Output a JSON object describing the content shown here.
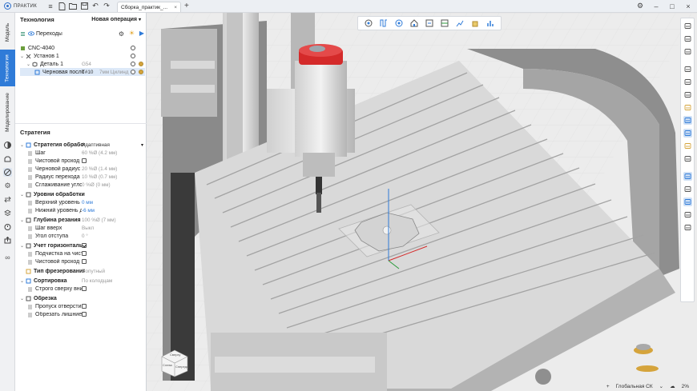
{
  "app": {
    "name": "ПРАКТИК"
  },
  "tabs": [
    {
      "label": "Сборка_практик_..."
    }
  ],
  "left_rail": {
    "tabs": [
      {
        "label": "Модель"
      },
      {
        "label": "Технология"
      },
      {
        "label": "Моделирование"
      }
    ]
  },
  "tech": {
    "title": "Технология",
    "new_op": "Новая операция",
    "transitions": "Переходы",
    "tree": [
      {
        "label": "CNC-4040",
        "value": ""
      },
      {
        "label": "Установ 1",
        "value": ""
      },
      {
        "label": "Деталь 1",
        "value": "G54"
      },
      {
        "label": "Черновая посло...",
        "value": "T#10",
        "extra": "7мм Цилинд"
      }
    ]
  },
  "strategy": {
    "title": "Стратегия",
    "groups": [
      {
        "label": "Стратегия обработ",
        "value": "Адаптивная",
        "items": [
          {
            "label": "Шаг",
            "value": "60 %Ø (4.2 мм)"
          },
          {
            "label": "Чистовой проход",
            "value": ""
          },
          {
            "label": "Черновой радиус",
            "value": "20 %Ø (1.4 мм)"
          },
          {
            "label": "Радиус перехода",
            "value": "10 %Ø (0.7 мм)"
          },
          {
            "label": "Сглаживание угло",
            "value": "0 %Ø (0 мм)"
          }
        ]
      },
      {
        "label": "Уровни обработки",
        "value": "",
        "items": [
          {
            "label": "Верхний уровень",
            "value": "0 мм"
          },
          {
            "label": "Нижний уровень д",
            "value": "-6 мм"
          }
        ]
      },
      {
        "label": "Глубина резания",
        "value": "100 %Ø (7 мм)",
        "items": [
          {
            "label": "Шаг вверх",
            "value": "Выкл"
          },
          {
            "label": "Угол отступа",
            "value": "0 °"
          }
        ]
      },
      {
        "label": "Учет горизонтальн",
        "value": "",
        "items": [
          {
            "label": "Подчистка на чист",
            "value": ""
          },
          {
            "label": "Чистовой проход",
            "value": ""
          }
        ]
      },
      {
        "label": "Тип фрезерования",
        "value": "Попутный",
        "items": []
      },
      {
        "label": "Сортировка",
        "value": "По колодцам",
        "items": [
          {
            "label": "Строго сверху вни",
            "value": ""
          }
        ]
      },
      {
        "label": "Обрезка",
        "value": "",
        "items": [
          {
            "label": "Пропуск отверсти",
            "value": ""
          },
          {
            "label": "Обрезать лишние",
            "value": ""
          }
        ]
      }
    ]
  },
  "viewcube": {
    "front": "Спереди",
    "left": "Слева",
    "top": "Сверху"
  },
  "status": {
    "cs": "Глобальная СК",
    "zoom": "2%"
  },
  "colors": {
    "accent": "#2f7bd8",
    "spindle_red": "#d42a2a",
    "tool_gold": "#d5a43c"
  }
}
